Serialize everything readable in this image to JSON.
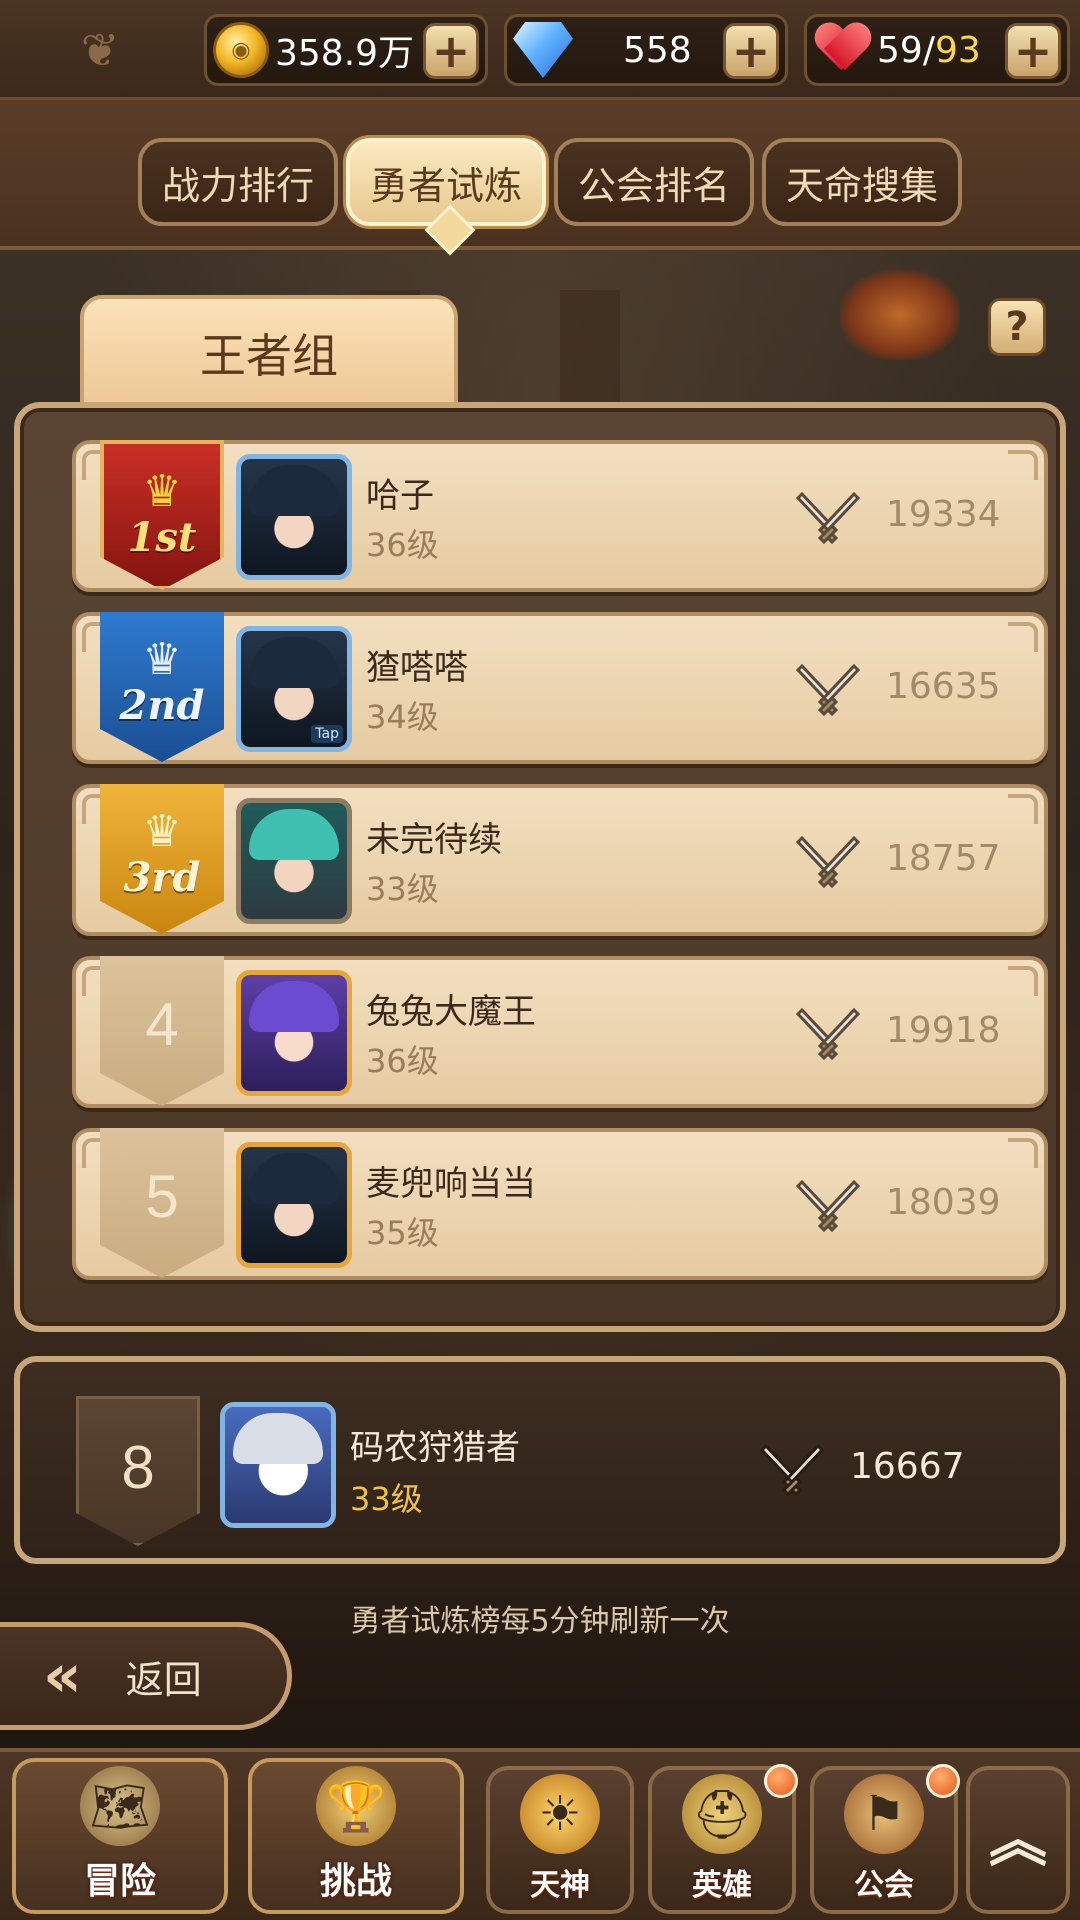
{
  "resources": {
    "gold": "358.9万",
    "gems": "558",
    "stamina_current": "59",
    "stamina_sep": "/",
    "stamina_max": "93"
  },
  "tabs": [
    {
      "label": "战力排行",
      "active": false
    },
    {
      "label": "勇者试炼",
      "active": true
    },
    {
      "label": "公会排名",
      "active": false
    },
    {
      "label": "天命搜集",
      "active": false
    }
  ],
  "group": {
    "title": "王者组",
    "help_label": "?"
  },
  "rankings": [
    {
      "rank": "1st",
      "name": "哈子",
      "level": "36级",
      "power": "19334",
      "medal": "gold-1",
      "avatar": "knight-dark"
    },
    {
      "rank": "2nd",
      "name": "猹嗒嗒",
      "level": "34级",
      "power": "16635",
      "medal": "silver-2",
      "avatar": "knight-dark",
      "avatar_tag": "Tap"
    },
    {
      "rank": "3rd",
      "name": "未完待续",
      "level": "33级",
      "power": "18757",
      "medal": "bronze-3",
      "avatar": "teal-ninja"
    },
    {
      "rank": "4",
      "name": "兔兔大魔王",
      "level": "36级",
      "power": "19918",
      "medal": "plain",
      "avatar": "purple-girl"
    },
    {
      "rank": "5",
      "name": "麦兜响当当",
      "level": "35级",
      "power": "18039",
      "medal": "plain",
      "avatar": "knight-dark"
    }
  ],
  "my_rank": {
    "rank": "8",
    "name": "码农狩猎者",
    "level": "33级",
    "power": "16667",
    "avatar": "white-wolf"
  },
  "refresh_note": "勇者试炼榜每5分钟刷新一次",
  "back_label": "返回",
  "bottom_nav": [
    {
      "label": "冒险",
      "icon": "map-scroll-icon"
    },
    {
      "label": "挑战",
      "icon": "trophy-icon"
    },
    {
      "label": "天神",
      "icon": "god-emblem-icon"
    },
    {
      "label": "英雄",
      "icon": "helmet-icon"
    },
    {
      "label": "公会",
      "icon": "guild-banner-icon"
    }
  ],
  "colors": {
    "accent_gold": "#ffd93d",
    "panel_border": "#c9a57a",
    "row_bg": "#f2dfc0"
  }
}
